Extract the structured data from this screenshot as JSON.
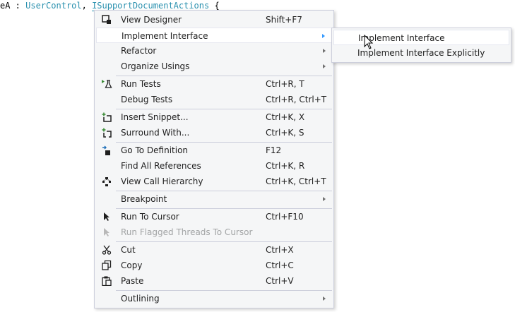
{
  "editor": {
    "code_prefix": "eA : ",
    "code_type": "UserControl",
    "code_comma": ", ",
    "code_iface": "ISupportDocumentActions",
    "code_suffix": " {"
  },
  "context_menu": {
    "items": [
      {
        "label": "View Designer",
        "shortcut": "Shift+F7",
        "icon": "view-designer-icon"
      },
      {
        "label": "Implement Interface",
        "shortcut": "",
        "submenu": true
      },
      {
        "label": "Refactor",
        "shortcut": "",
        "submenu": true
      },
      {
        "label": "Organize Usings",
        "shortcut": "",
        "submenu": true
      },
      {
        "label": "Run Tests",
        "shortcut": "Ctrl+R, T",
        "icon": "run-tests-icon"
      },
      {
        "label": "Debug Tests",
        "shortcut": "Ctrl+R, Ctrl+T"
      },
      {
        "label": "Insert Snippet...",
        "shortcut": "Ctrl+K, X",
        "icon": "insert-snippet-icon"
      },
      {
        "label": "Surround With...",
        "shortcut": "Ctrl+K, S",
        "icon": "surround-with-icon"
      },
      {
        "label": "Go To Definition",
        "shortcut": "F12",
        "icon": "go-to-definition-icon"
      },
      {
        "label": "Find All References",
        "shortcut": "Ctrl+K, R"
      },
      {
        "label": "View Call Hierarchy",
        "shortcut": "Ctrl+K, Ctrl+T",
        "icon": "call-hierarchy-icon"
      },
      {
        "label": "Breakpoint",
        "shortcut": "",
        "submenu": true
      },
      {
        "label": "Run To Cursor",
        "shortcut": "Ctrl+F10",
        "icon": "run-to-cursor-icon"
      },
      {
        "label": "Run Flagged Threads To Cursor",
        "shortcut": "",
        "disabled": true,
        "icon": "run-flagged-threads-icon"
      },
      {
        "label": "Cut",
        "shortcut": "Ctrl+X",
        "icon": "scissors-icon"
      },
      {
        "label": "Copy",
        "shortcut": "Ctrl+C",
        "icon": "copy-icon"
      },
      {
        "label": "Paste",
        "shortcut": "Ctrl+V",
        "icon": "paste-icon"
      },
      {
        "label": "Outlining",
        "shortcut": "",
        "submenu": true
      }
    ]
  },
  "submenu": {
    "items": [
      {
        "label": "Implement Interface"
      },
      {
        "label": "Implement Interface Explicitly"
      }
    ]
  },
  "colors": {
    "menu_background": "#f5f6f7",
    "menu_border": "#cccedb",
    "hover_background": "#ffffff",
    "disabled_text": "#a2a4a5",
    "type_color": "#2b91af"
  }
}
